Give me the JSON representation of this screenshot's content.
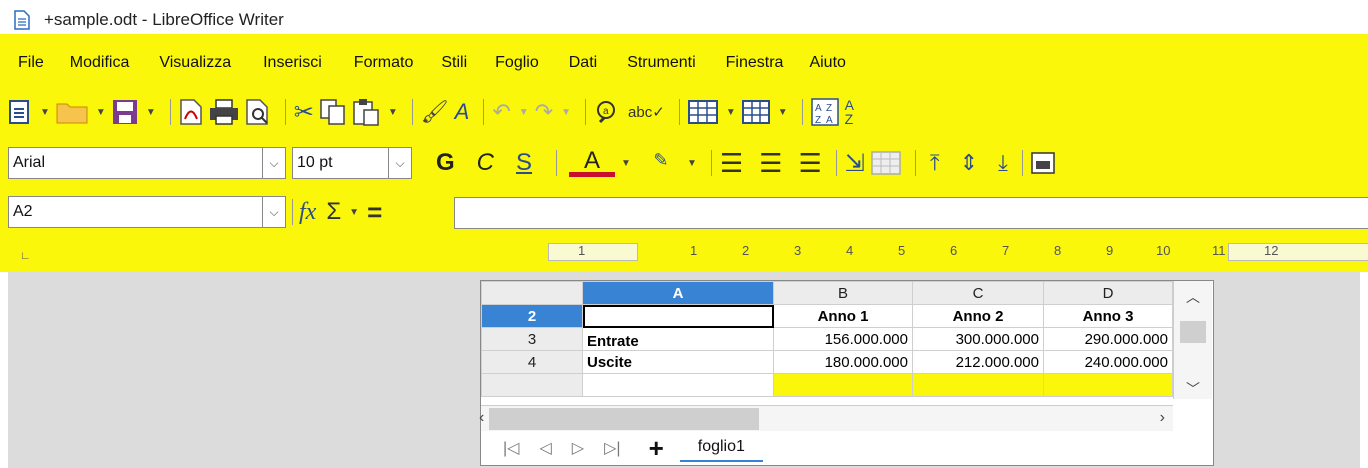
{
  "window": {
    "title": "+sample.odt - LibreOffice Writer"
  },
  "menu": [
    "File",
    "Modifica",
    "Visualizza",
    "Inserisci",
    "Formato",
    "Stili",
    "Foglio",
    "Dati",
    "Strumenti",
    "Finestra",
    "Aiuto"
  ],
  "toolbar_icons": [
    "new-icon",
    "open-folder-icon",
    "save-icon",
    "export-pdf-icon",
    "print-icon",
    "print-preview-icon",
    "cut-icon",
    "copy-icon",
    "paste-icon",
    "clone-format-icon",
    "clear-format-icon",
    "undo-icon",
    "redo-icon",
    "find-replace-icon",
    "spellcheck-icon",
    "table-icon",
    "table-columns-icon",
    "sort-icon",
    "sort-ascending-icon"
  ],
  "format": {
    "font": "Arial",
    "size": "10 pt",
    "bold": "G",
    "italic": "C",
    "underline": "S",
    "font_color": "A"
  },
  "formula": {
    "cell_ref": "A2",
    "fx": "fx",
    "sum": "Σ",
    "eq": "="
  },
  "ruler": {
    "labels": [
      "1",
      "1",
      "2",
      "3",
      "4",
      "5",
      "6",
      "7",
      "8",
      "9",
      "10",
      "11",
      "12"
    ]
  },
  "sheet": {
    "columns": [
      "A",
      "B",
      "C",
      "D"
    ],
    "rows": [
      {
        "num": "2",
        "cells": [
          "",
          "Anno 1",
          "Anno 2",
          "Anno 3"
        ]
      },
      {
        "num": "3",
        "cells": [
          "Entrate",
          "156.000.000",
          "300.000.000",
          "290.000.000"
        ]
      },
      {
        "num": "4",
        "cells": [
          "Uscite",
          "180.000.000",
          "212.000.000",
          "240.000.000"
        ]
      }
    ],
    "tab": "foglio1"
  },
  "colors": {
    "highlight": "#fbf70b",
    "selection": "#3983d5"
  }
}
